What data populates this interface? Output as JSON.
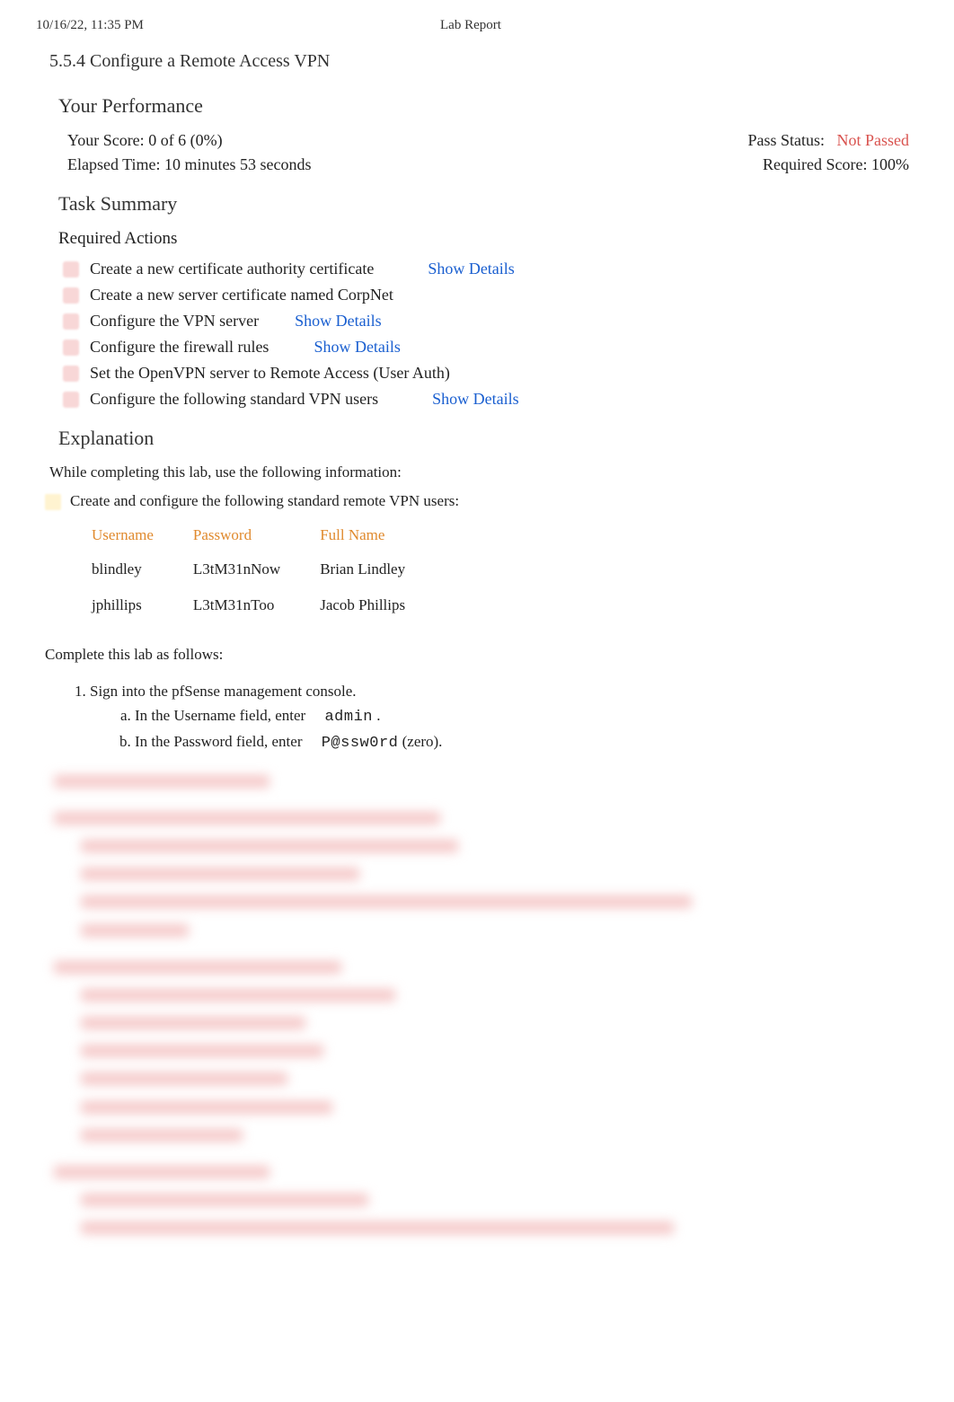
{
  "header": {
    "datetime": "10/16/22, 11:35 PM",
    "doc_title": "Lab Report"
  },
  "lab": {
    "number_title": "5.5.4 Configure a Remote Access VPN"
  },
  "performance": {
    "heading": "Your Performance",
    "score_label": "Your Score:",
    "score_value": "0 of 6 (0%)",
    "pass_label": "Pass Status:",
    "pass_value": "Not Passed",
    "elapsed_label": "Elapsed Time:",
    "elapsed_value": "10 minutes 53 seconds",
    "required_label": "Required Score:",
    "required_value": "100%"
  },
  "task_summary": {
    "heading": "Task Summary",
    "sub_heading": "Required Actions",
    "show_details": "Show Details",
    "actions": [
      {
        "text": "Create a new certificate authority certificate",
        "details": true
      },
      {
        "text": "Create a new server certificate named CorpNet",
        "details": false
      },
      {
        "text": "Configure the VPN server",
        "details": true
      },
      {
        "text": "Configure the firewall rules",
        "details": true
      },
      {
        "text": "Set the OpenVPN server to Remote Access (User Auth)",
        "details": false
      },
      {
        "text": "Configure the following standard VPN users",
        "details": true
      }
    ]
  },
  "explanation": {
    "heading": "Explanation",
    "intro": "While completing this lab, use the following information:",
    "bullet": "Create and configure the following standard remote VPN users:",
    "table": {
      "headers": [
        "Username",
        "Password",
        "Full Name"
      ],
      "rows": [
        [
          "blindley",
          "L3tM31nNow",
          "Brian Lindley"
        ],
        [
          "jphillips",
          "L3tM31nToo",
          "Jacob Phillips"
        ]
      ]
    },
    "complete": "Complete this lab as follows:",
    "step1": {
      "text": "Sign into the pfSense management console.",
      "a_pre": "In the Username field, enter ",
      "a_val": "admin",
      "a_post": ".",
      "b_pre": "In the Password field, enter ",
      "b_val": "P@ssw0rd",
      "b_post": " (zero)."
    }
  }
}
